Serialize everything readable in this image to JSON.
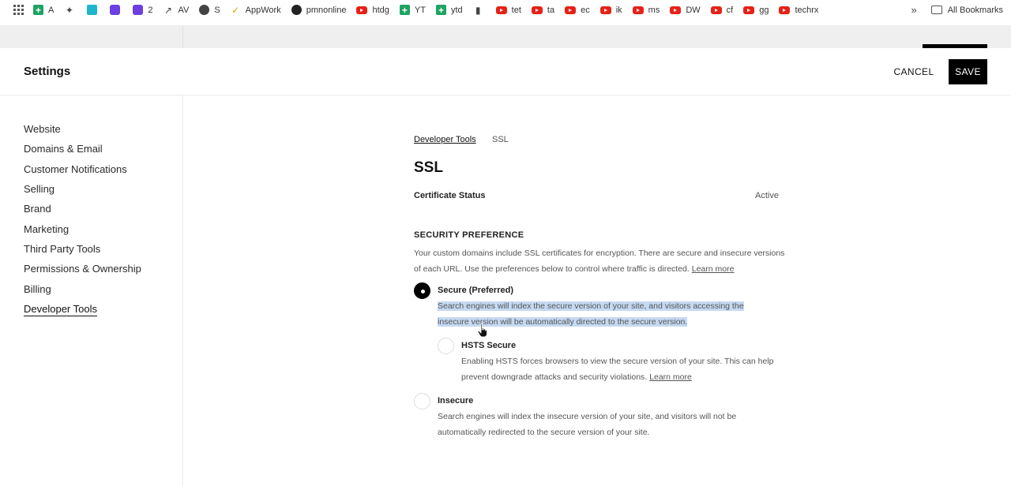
{
  "bookmarks": [
    {
      "label": "A",
      "icon": "sheets-icon"
    },
    {
      "label": "",
      "icon": "puzzle-icon"
    },
    {
      "label": "",
      "icon": "teal-app-icon"
    },
    {
      "label": "",
      "icon": "heart-chat-icon"
    },
    {
      "label": "2",
      "icon": "heart-chat-icon"
    },
    {
      "label": "AV",
      "icon": "trend-icon"
    },
    {
      "label": "S",
      "icon": "globe-icon"
    },
    {
      "label": "AppWork",
      "icon": "check-icon"
    },
    {
      "label": "pmnonline",
      "icon": "github-icon"
    },
    {
      "label": "htdg",
      "icon": "youtube-icon"
    },
    {
      "label": "YT",
      "icon": "sheets-icon"
    },
    {
      "label": "ytd",
      "icon": "sheets-icon"
    },
    {
      "label": "",
      "icon": "pin-icon"
    },
    {
      "label": "tet",
      "icon": "youtube-icon"
    },
    {
      "label": "ta",
      "icon": "youtube-icon"
    },
    {
      "label": "ec",
      "icon": "youtube-icon"
    },
    {
      "label": "ik",
      "icon": "youtube-icon"
    },
    {
      "label": "ms",
      "icon": "youtube-icon"
    },
    {
      "label": "DW",
      "icon": "youtube-icon"
    },
    {
      "label": "cf",
      "icon": "youtube-icon"
    },
    {
      "label": "gg",
      "icon": "youtube-icon"
    },
    {
      "label": "techrx",
      "icon": "youtube-icon"
    }
  ],
  "bookmarks_more": "»",
  "all_bookmarks": "All Bookmarks",
  "header": {
    "title": "Settings",
    "cancel": "CANCEL",
    "save": "SAVE"
  },
  "sidebar": {
    "items": [
      {
        "label": "Website"
      },
      {
        "label": "Domains & Email"
      },
      {
        "label": "Customer Notifications"
      },
      {
        "label": "Selling"
      },
      {
        "label": "Brand"
      },
      {
        "label": "Marketing"
      },
      {
        "label": "Third Party Tools"
      },
      {
        "label": "Permissions & Ownership"
      },
      {
        "label": "Billing"
      },
      {
        "label": "Developer Tools",
        "active": true
      }
    ]
  },
  "main": {
    "breadcrumb_parent": "Developer Tools",
    "breadcrumb_current": "SSL",
    "title": "SSL",
    "certificate_label": "Certificate Status",
    "certificate_value": "Active",
    "security_heading": "SECURITY PREFERENCE",
    "security_desc": "Your custom domains include SSL certificates for encryption. There are secure and insecure versions of each URL. Use the preferences below to control where traffic is directed.",
    "learn_more": "Learn more",
    "options": {
      "secure": {
        "title": "Secure (Preferred)",
        "desc": "Search engines will index the secure version of your site, and visitors accessing the insecure version will be automatically directed to the secure version.",
        "selected": true
      },
      "hsts": {
        "title": "HSTS Secure",
        "desc": "Enabling HSTS forces browsers to view the secure version of your site. This can help prevent downgrade attacks and security violations.",
        "learn_more": "Learn more",
        "selected": false
      },
      "insecure": {
        "title": "Insecure",
        "desc": "Search engines will index the insecure version of your site, and visitors will not be automatically redirected to the secure version of your site.",
        "selected": false
      }
    }
  }
}
